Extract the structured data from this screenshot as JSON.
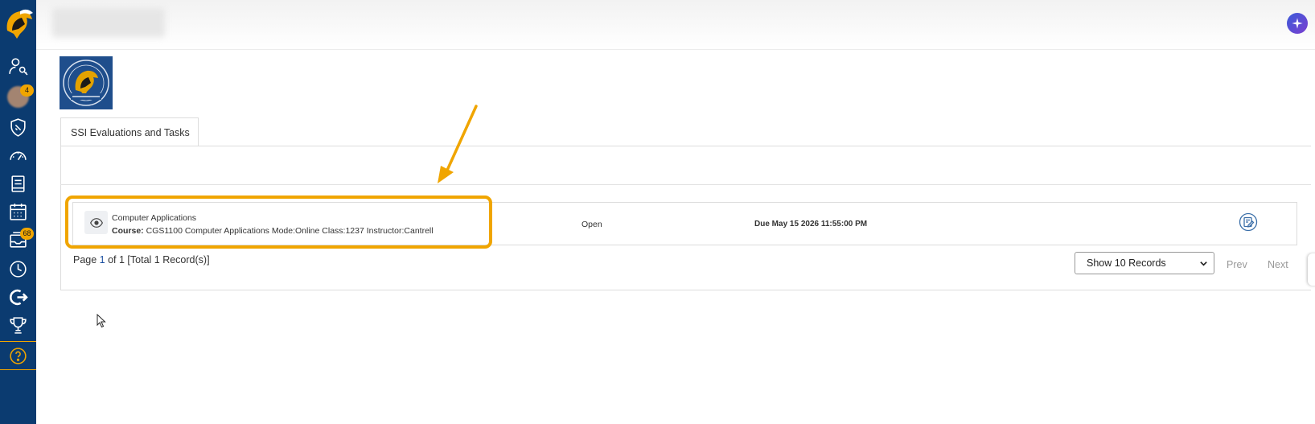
{
  "sidebar": {
    "items": [
      {
        "name": "user-key-icon"
      },
      {
        "name": "avatar",
        "badge": "4"
      },
      {
        "name": "shield-tag-icon"
      },
      {
        "name": "speedometer-icon"
      },
      {
        "name": "book-icon"
      },
      {
        "name": "calendar-icon"
      },
      {
        "name": "inbox-icon",
        "badge": "68"
      },
      {
        "name": "clock-icon"
      },
      {
        "name": "logout-icon"
      },
      {
        "name": "trophy-icon"
      },
      {
        "name": "help-icon"
      }
    ]
  },
  "tab": {
    "label": "SSI Evaluations and Tasks"
  },
  "evaluation": {
    "course_name": "Computer Applications",
    "course_prefix": "Course:",
    "course_details": " CGS1100 Computer Applications Mode:Online Class:1237 Instructor:Cantrell",
    "status": "Open",
    "due_prefix": "Due",
    "due_value": " May 15 2026 11:55:00 PM"
  },
  "pagination": {
    "page_prefix": "Page ",
    "current_page": "1",
    "page_suffix": " of 1 [Total 1 Record(s)]",
    "records_select": "Show 10 Records",
    "prev_label": "Prev",
    "next_label": "Next"
  },
  "colors": {
    "sidebar_bg": "#0b3b70",
    "highlight": "#f0a500",
    "badge": "#f0a500"
  }
}
